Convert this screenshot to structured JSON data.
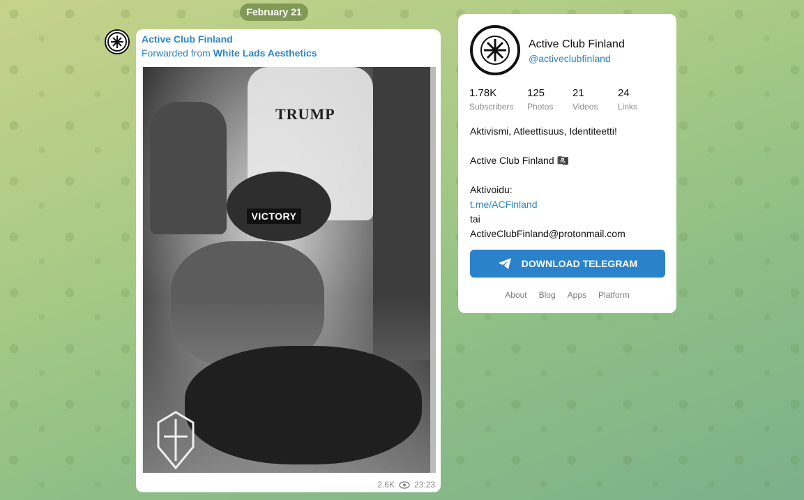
{
  "feed": {
    "date": "February 21"
  },
  "post": {
    "author": "Active Club Finland",
    "forwarded_prefix": "Forwarded from ",
    "forwarded_source": "White Lads Aesthetics",
    "image_text": "TRUMP",
    "overlay_label": "VICTORY",
    "views": "2.6K",
    "time": "23:23"
  },
  "channel": {
    "name": "Active Club Finland",
    "handle": "@activeclubfinland",
    "stats": [
      {
        "num": "1.78K",
        "label": "Subscribers"
      },
      {
        "num": "125",
        "label": "Photos"
      },
      {
        "num": "21",
        "label": "Videos"
      },
      {
        "num": "24",
        "label": "Links"
      }
    ],
    "desc_line1": "Aktivismi, Atleettisuus, Identiteetti!",
    "desc_line2": "Active Club Finland 🏴‍☠️",
    "desc_line3": "Aktivoidu:",
    "desc_link": "t.me/ACFinland",
    "desc_line4": "tai",
    "desc_email": "ActiveClubFinland@protonmail.com",
    "download_label": "DOWNLOAD TELEGRAM",
    "footer_links": [
      "About",
      "Blog",
      "Apps",
      "Platform"
    ]
  },
  "colors": {
    "accent": "#2a86c8",
    "button": "#2a82ca"
  },
  "icons": [
    "eye-icon",
    "telegram-plane-icon",
    "club-logo-icon"
  ]
}
